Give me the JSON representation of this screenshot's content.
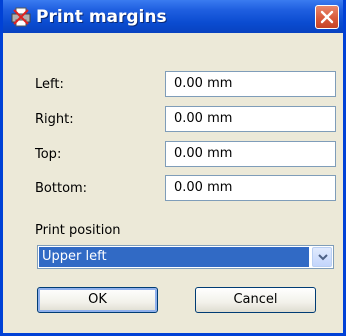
{
  "window": {
    "title": "Print margins",
    "icon": "printer-icon",
    "close_icon": "close-icon"
  },
  "margins": [
    {
      "label": "Left:",
      "value": "0.00 mm"
    },
    {
      "label": "Right:",
      "value": "0.00 mm"
    },
    {
      "label": "Top:",
      "value": "0.00 mm"
    },
    {
      "label": "Bottom:",
      "value": "0.00 mm"
    }
  ],
  "print_position": {
    "label": "Print position",
    "selected": "Upper left",
    "arrow_icon": "chevron-down-icon"
  },
  "buttons": {
    "ok": "OK",
    "cancel": "Cancel"
  },
  "colors": {
    "titlebar": "#0a4bd0",
    "close": "#d95a3b",
    "selection": "#316ac5",
    "dialog_bg": "#ece9d8"
  }
}
